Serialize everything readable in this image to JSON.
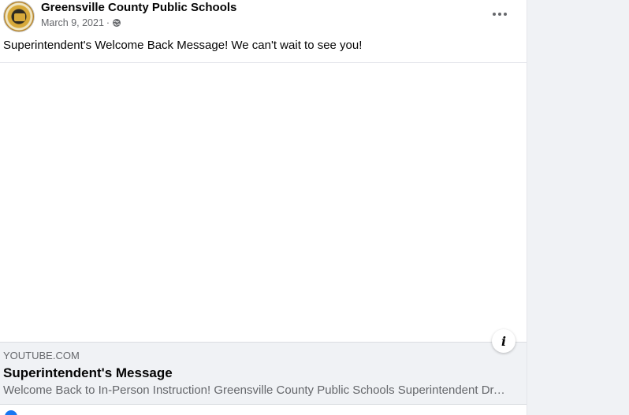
{
  "post": {
    "page_name": "Greensville County Public Schools",
    "date": "March 9, 2021",
    "separator": "·",
    "privacy_icon": "globe-icon",
    "more_icon": "more-options-icon",
    "message": "Superintendent's Welcome Back Message! We can't wait to see you!"
  },
  "link_card": {
    "domain": "YOUTUBE.COM",
    "title": "Superintendent's Message",
    "description": "Welcome Back to In-Person Instruction! Greensville County Public Schools Superintendent Dr. ...",
    "info_icon": "info-icon",
    "info_glyph": "i"
  },
  "colors": {
    "text_primary": "#050505",
    "text_secondary": "#65676b",
    "card_background": "#f0f2f5",
    "accent": "#1877f2"
  }
}
